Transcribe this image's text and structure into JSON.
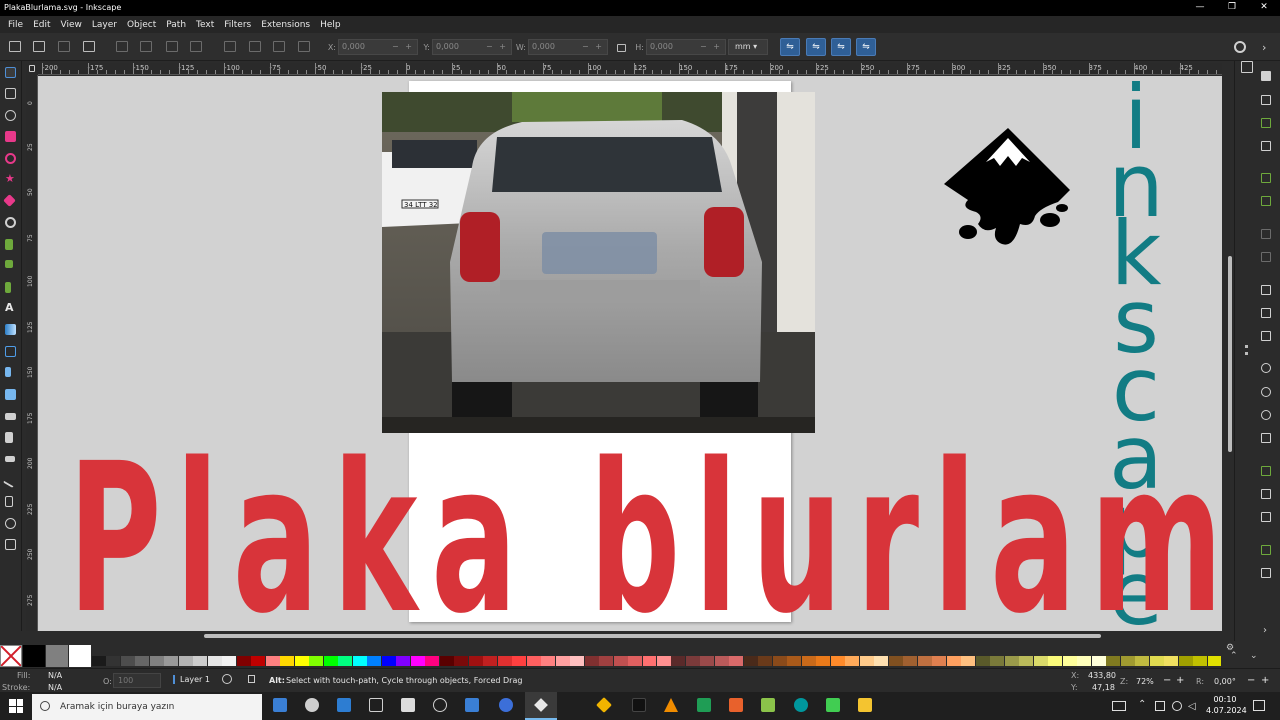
{
  "window": {
    "title": "PlakaBlurlama.svg - Inkscape",
    "min": "—",
    "max": "❐",
    "close": "✕"
  },
  "menu": [
    "File",
    "Edit",
    "View",
    "Layer",
    "Object",
    "Path",
    "Text",
    "Filters",
    "Extensions",
    "Help"
  ],
  "toolbar": {
    "x_label": "X:",
    "x_value": "0,000",
    "y_label": "Y:",
    "y_value": "0,000",
    "w_label": "W:",
    "w_value": "0,000",
    "h_label": "H:",
    "h_value": "0,000",
    "unit": "mm ▾"
  },
  "ruler_top": [
    "-200",
    "-175",
    "-150",
    "-125",
    "-100",
    "-75",
    "-50",
    "-25",
    "0",
    "25",
    "50",
    "75",
    "100",
    "125",
    "150",
    "175",
    "200",
    "225",
    "250",
    "275",
    "300",
    "325",
    "350",
    "375",
    "400",
    "425"
  ],
  "ruler_left": [
    "0",
    "25",
    "50",
    "75",
    "100",
    "125",
    "150",
    "175",
    "200",
    "225",
    "250",
    "275"
  ],
  "canvas": {
    "big_text": "Plaka blurlama",
    "vertical_text": [
      "i",
      "n",
      "k",
      "s",
      "c",
      "a",
      "p",
      "e"
    ],
    "plate_left": "34 LTT 32"
  },
  "status": {
    "fill_label": "Fill:",
    "fill_value": "N/A",
    "stroke_label": "Stroke:",
    "stroke_value": "N/A",
    "opacity_label": "O:",
    "opacity_value": "100",
    "layer": "Layer 1",
    "hint_bold": "Alt:",
    "hint": "Select with touch-path, Cycle through objects, Forced Drag",
    "x_label": "X:",
    "x_value": "433,80",
    "y_label": "Y:",
    "y_value": "47,18",
    "zoom_label": "Z:",
    "zoom_value": "72%",
    "rot_label": "R:",
    "rot_value": "0,00°"
  },
  "taskbar": {
    "search_placeholder": "Aramak için buraya yazın",
    "time": "00:10",
    "date": "4.07.2024"
  },
  "colors": {
    "accent": "#2f5f96",
    "text_red": "#d8343a",
    "text_teal": "#127c84",
    "canvas": "#d2d2d2"
  }
}
